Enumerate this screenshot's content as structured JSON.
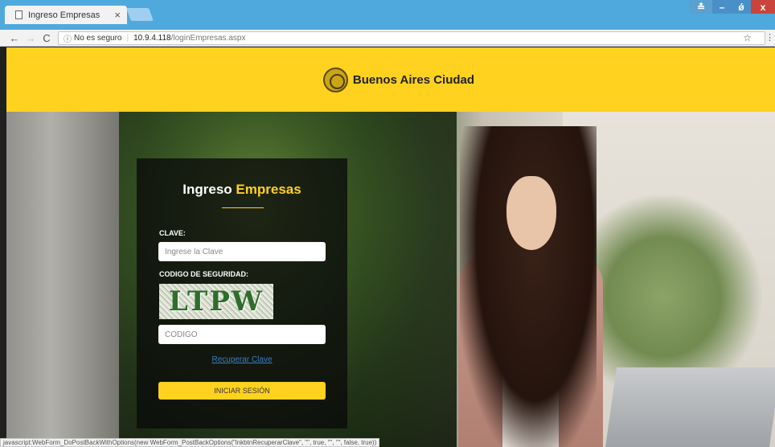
{
  "browser": {
    "tab_title": "Ingreso Empresas",
    "tab_close": "×",
    "security_label": "No es seguro",
    "url_host": "10.9.4.118",
    "url_path": "/loginEmpresas.aspx",
    "back": "←",
    "forward": "→",
    "reload": "C",
    "info": "ⓘ",
    "star": "☆",
    "menu": "⋮",
    "win_min": "–",
    "win_max": "ǿ",
    "win_close": "x",
    "win_user": "≛"
  },
  "header": {
    "logo_text": "Buenos Aires Ciudad"
  },
  "login": {
    "title_prefix": "Ingreso",
    "title_accent": "Empresas",
    "clave_label": "CLAVE:",
    "clave_placeholder": "Ingrese la Clave",
    "seguridad_label": "CODIGO DE SEGURIDAD:",
    "captcha_text": "LTPW",
    "codigo_placeholder": "CODIGO",
    "recover_link": "Recuperar Clave",
    "submit_label": "INICIAR SESIÓN"
  },
  "status": {
    "text": "javascript:WebForm_DoPostBackWithOptions(new WebForm_PostBackOptions(\"lnkbtnRecuperarClave\", \"\", true, \"\", \"\", false, true))"
  },
  "colors": {
    "brand_yellow": "#ffd21f",
    "link_blue": "#3b7fc4",
    "chrome_blue": "#4fa9dd"
  }
}
